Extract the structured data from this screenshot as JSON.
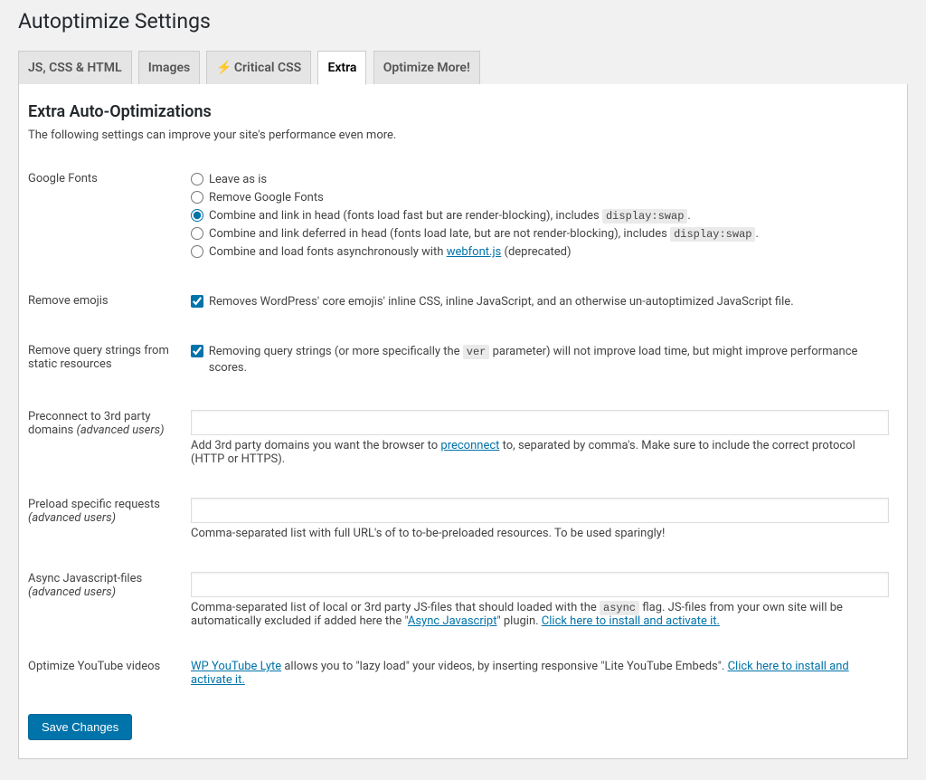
{
  "page_title": "Autoptimize Settings",
  "tabs": [
    {
      "label": "JS, CSS & HTML"
    },
    {
      "label": "Images"
    },
    {
      "label": "Critical CSS",
      "icon": "⚡"
    },
    {
      "label": "Extra",
      "active": true
    },
    {
      "label": "Optimize More!"
    }
  ],
  "section": {
    "title": "Extra Auto-Optimizations",
    "desc": "The following settings can improve your site's performance even more."
  },
  "google_fonts": {
    "label": "Google Fonts",
    "options": {
      "leave": "Leave as is",
      "remove": "Remove Google Fonts",
      "combine_head_pre": "Combine and link in head (fonts load fast but are render-blocking), includes ",
      "combine_head_code": "display:swap",
      "combine_head_post": ".",
      "combine_deferred_pre": "Combine and link deferred in head (fonts load late, but are not render-blocking), includes ",
      "combine_deferred_code": "display:swap",
      "combine_deferred_post": ".",
      "async_pre": "Combine and load fonts asynchronously with ",
      "async_link": "webfont.js",
      "async_post": " (deprecated)"
    }
  },
  "remove_emojis": {
    "label": "Remove emojis",
    "desc": "Removes WordPress' core emojis' inline CSS, inline JavaScript, and an otherwise un-autoptimized JavaScript file."
  },
  "remove_query": {
    "label": "Remove query strings from static resources",
    "desc_pre": "Removing query strings (or more specifically the ",
    "desc_code": "ver",
    "desc_post": " parameter) will not improve load time, but might improve performance scores."
  },
  "preconnect": {
    "label_main": "Preconnect to 3rd party domains ",
    "label_adv": "(advanced users)",
    "help_pre": "Add 3rd party domains you want the browser to ",
    "help_link": "preconnect",
    "help_post": " to, separated by comma's. Make sure to include the correct protocol (HTTP or HTTPS)."
  },
  "preload": {
    "label_main": "Preload specific requests ",
    "label_adv": "(advanced users)",
    "help": "Comma-separated list with full URL's of to to-be-preloaded resources. To be used sparingly!"
  },
  "async_js": {
    "label_main": "Async Javascript-files ",
    "label_adv": "(advanced users)",
    "help_pre": "Comma-separated list of local or 3rd party JS-files that should loaded with the ",
    "help_code": "async",
    "help_mid": " flag. JS-files from your own site will be automatically excluded if added here the \"",
    "help_plugin_link": "Async Javascript",
    "help_post_quote": "\" plugin. ",
    "help_install_link": "Click here to install and activate it."
  },
  "youtube": {
    "label": "Optimize YouTube videos",
    "link1": "WP YouTube Lyte",
    "mid": " allows you to \"lazy load\" your videos, by inserting responsive \"Lite YouTube Embeds\". ",
    "link2": "Click here to install and activate it."
  },
  "save_button": "Save Changes"
}
